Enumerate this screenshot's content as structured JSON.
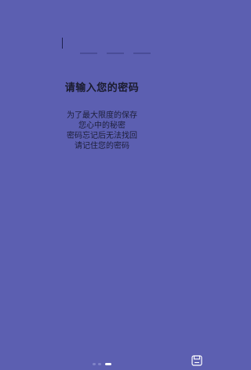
{
  "setup": {
    "title": "请输入您的密码",
    "description_lines": [
      "为了最大限度的保存",
      "您心中的秘密",
      "密码忘记后无法找回",
      "请记住您的密码"
    ],
    "pin_slots": 3,
    "page_indicator": {
      "current": 3,
      "total": 3
    }
  },
  "icons": {
    "save": "save-icon"
  },
  "colors": {
    "background": "#5c5fb1",
    "text": "#1b1c2e",
    "active_dot": "#ffffff"
  }
}
